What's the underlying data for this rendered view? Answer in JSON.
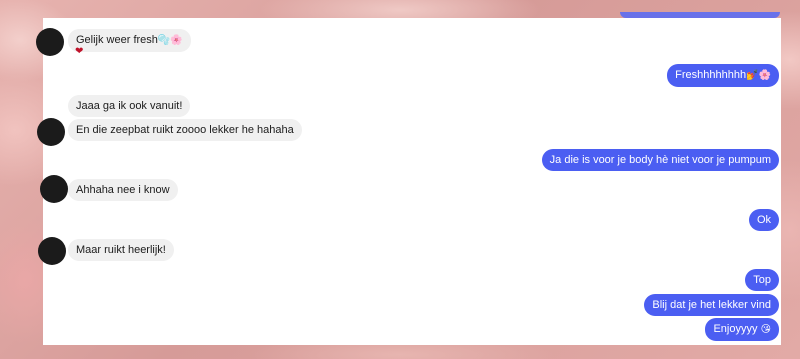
{
  "messages": {
    "m1_text": "Gelijk weer fresh",
    "m1_emoji": "🫧🌸",
    "m1_reaction": "❤",
    "m2_text": "Freshhhhhhhh",
    "m2_emoji": "💅🌸",
    "m3_text": "Jaaa ga ik ook vanuit!",
    "m4_text": "En die zeepbat ruikt zoooo lekker he hahaha",
    "m5_text": "Ja die is voor je body hè niet voor je pumpum",
    "m6_text": "Ahhaha nee i know",
    "m7_text": "Ok",
    "m8_text": "Maar ruikt heerlijk!",
    "m9_text": "Top",
    "m10_text": "Blij dat je het lekker vind",
    "m11_text": "Enjoyyyy",
    "m11_emoji": "😘"
  },
  "colors": {
    "outgoing_bubble": "#4b5ef2",
    "incoming_bubble": "#f0f0f0",
    "avatar": "#1b1b1b"
  }
}
